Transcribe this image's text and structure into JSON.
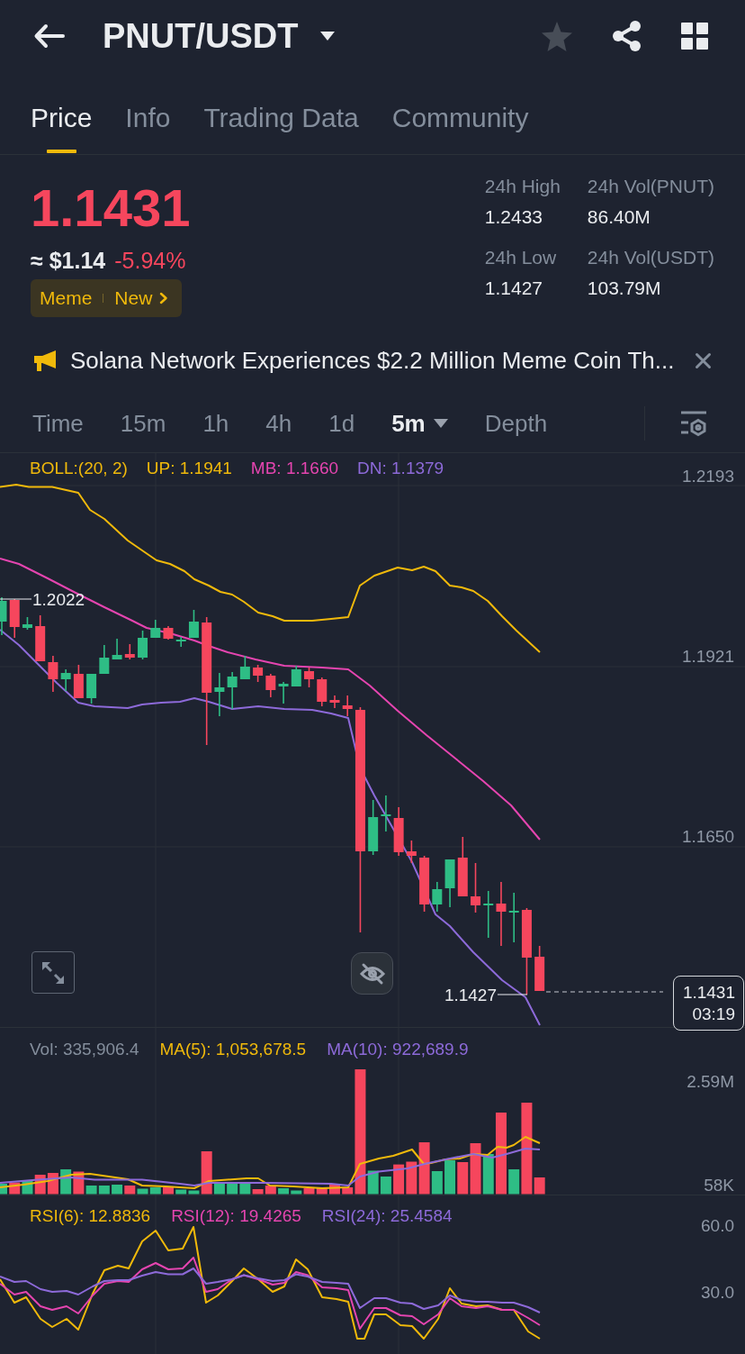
{
  "header": {
    "title": "PNUT/USDT",
    "favorite": false
  },
  "tabs": [
    {
      "label": "Price",
      "selected": true
    },
    {
      "label": "Info",
      "selected": false
    },
    {
      "label": "Trading Data",
      "selected": false
    },
    {
      "label": "Community",
      "selected": false
    }
  ],
  "price": {
    "last": "1.1431",
    "usd": "≈ $1.14",
    "change": "-5.94%"
  },
  "tags": [
    "Meme",
    "New"
  ],
  "stats": [
    {
      "label": "24h High",
      "value": "1.2433"
    },
    {
      "label": "24h Vol(PNUT)",
      "value": "86.40M"
    },
    {
      "label": "24h Low",
      "value": "1.1427"
    },
    {
      "label": "24h Vol(USDT)",
      "value": "103.79M"
    }
  ],
  "announcement": {
    "text": "Solana Network Experiences $2.2 Million Meme Coin Th..."
  },
  "intervals": [
    {
      "label": "Time",
      "kind": "option",
      "selected": false
    },
    {
      "label": "15m",
      "kind": "option",
      "selected": false
    },
    {
      "label": "1h",
      "kind": "option",
      "selected": false
    },
    {
      "label": "4h",
      "kind": "option",
      "selected": false
    },
    {
      "label": "1d",
      "kind": "option",
      "selected": false
    },
    {
      "label": "5m",
      "kind": "menu",
      "selected": true
    },
    {
      "label": "Depth",
      "kind": "option",
      "selected": false
    }
  ],
  "main_chart": {
    "legend": [
      {
        "label": "BOLL:(20, 2)",
        "color": "#f0b90b"
      },
      {
        "label": "UP: 1.1941",
        "color": "#f0b90b"
      },
      {
        "label": "MB: 1.1660",
        "color": "#e545b0"
      },
      {
        "label": "DN: 1.1379",
        "color": "#8d6ad9"
      }
    ],
    "y_labels": [
      "1.2193",
      "1.1921",
      "1.1650"
    ],
    "high_label": "1.2022",
    "low_label": "1.1427",
    "last_price": "1.1431",
    "countdown": "03:19"
  },
  "volume_chart": {
    "legend": [
      {
        "label": "Vol: 335,906.4",
        "color": "#848e9c"
      },
      {
        "label": "MA(5): 1,053,678.5",
        "color": "#f0b90b"
      },
      {
        "label": "MA(10): 922,689.9",
        "color": "#8d6ad9"
      }
    ],
    "y_labels": [
      "2.59M",
      "58K"
    ]
  },
  "rsi_chart": {
    "legend": [
      {
        "label": "RSI(6): 12.8836",
        "color": "#f0b90b"
      },
      {
        "label": "RSI(12): 19.4265",
        "color": "#e545b0"
      },
      {
        "label": "RSI(24): 25.4584",
        "color": "#8d6ad9"
      }
    ],
    "y_labels": [
      "60.0",
      "30.0"
    ]
  }
}
